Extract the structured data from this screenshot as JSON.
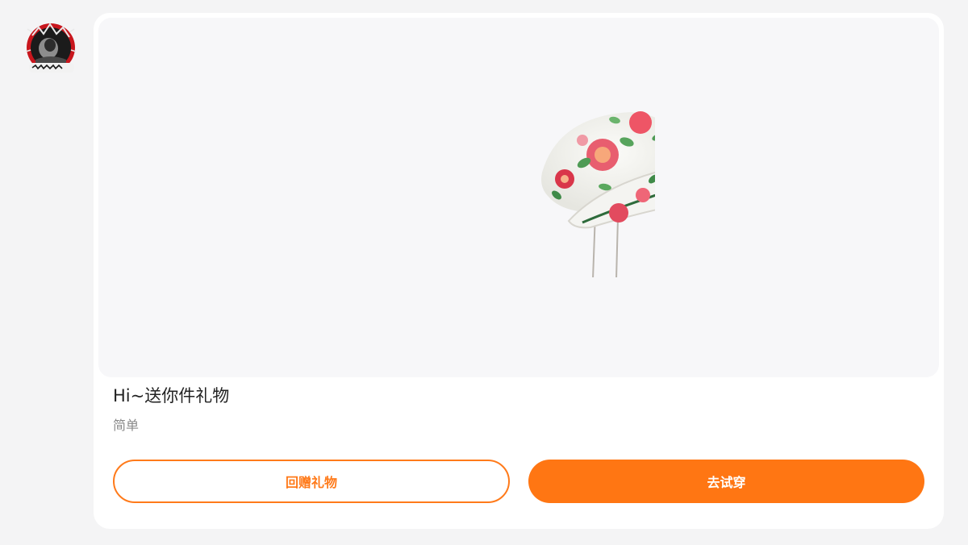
{
  "avatar": {
    "icon": "user-avatar"
  },
  "gift": {
    "title": "Hi~送你件礼物",
    "subtitle": "简单",
    "image_icon": "floral-hat"
  },
  "actions": {
    "return_gift_label": "回赠礼物",
    "try_on_label": "去试穿"
  },
  "colors": {
    "accent": "#ff7613",
    "background": "#f4f4f5",
    "card": "#ffffff",
    "title_text": "#222222",
    "subtitle_text": "#8a8a8a"
  }
}
